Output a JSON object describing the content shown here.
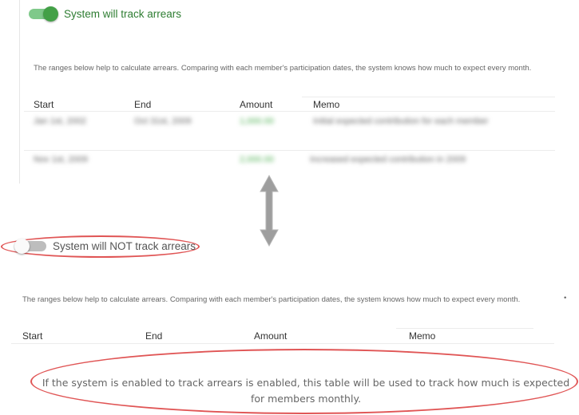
{
  "top": {
    "toggle_label": "System will track arrears",
    "help_text": "The ranges below help to calculate arrears. Comparing with each member's participation dates, the system knows how much to expect every month.",
    "columns": [
      "Start",
      "End",
      "Amount",
      "Memo"
    ],
    "rows": [
      {
        "start": "Jan 1st, 2002",
        "end": "Oct 31st, 2009",
        "amount": "1,000.00",
        "memo": "Initial expected contribution for each member"
      },
      {
        "start": "Nov 1st, 2009",
        "end": "",
        "amount": "2,000.00",
        "memo": "Increased expected contribution in 2009"
      }
    ]
  },
  "bottom": {
    "toggle_label": "System will NOT track arrears",
    "help_text": "The ranges below help to calculate arrears. Comparing with each member's participation dates, the system knows how much to expect every month.",
    "bullet": "•",
    "columns": [
      "Start",
      "End",
      "Amount",
      "Memo"
    ],
    "empty_note": "If the system is enabled to track arrears is enabled, this table will be used to track how much is expected for members monthly."
  },
  "colors": {
    "accent_green": "#43a047",
    "annotation_red": "#e05555",
    "arrow_gray": "#9e9e9e"
  },
  "icons": {
    "arrow": "double-headed-vertical-arrow-icon"
  }
}
